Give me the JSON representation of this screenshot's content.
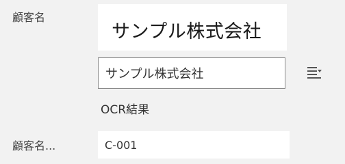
{
  "customer_name": {
    "label": "顧客名",
    "ocr_image_text": "サンプル株式会社",
    "value": "サンプル株式会社",
    "ocr_caption": "OCR結果"
  },
  "customer_code": {
    "label": "顧客名...",
    "value": "C-001"
  },
  "icons": {
    "list_select": "list-select-icon"
  }
}
